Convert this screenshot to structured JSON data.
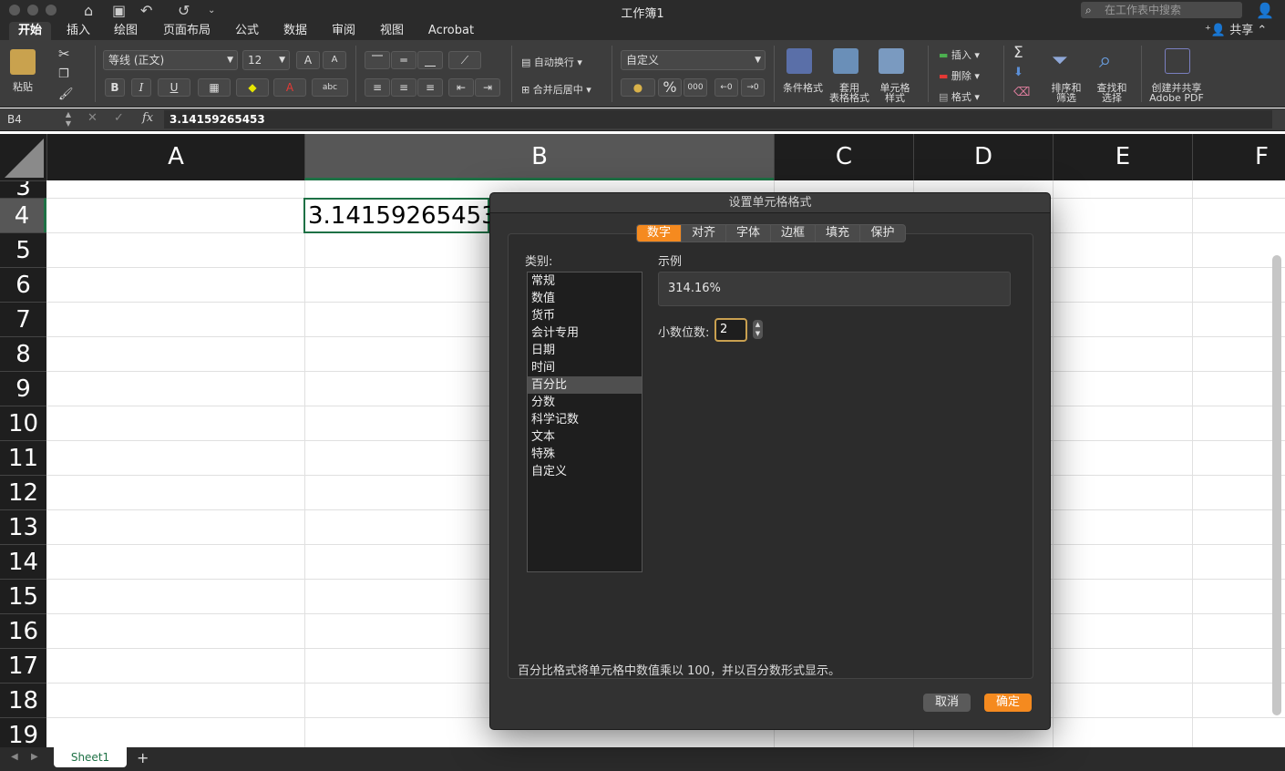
{
  "window": {
    "title": "工作簿1"
  },
  "search": {
    "placeholder": "在工作表中搜索"
  },
  "share": {
    "label": "共享"
  },
  "tabs": [
    "开始",
    "插入",
    "绘图",
    "页面布局",
    "公式",
    "数据",
    "审阅",
    "视图",
    "Acrobat"
  ],
  "ribbon": {
    "paste": "粘贴",
    "font_name": "等线 (正文)",
    "font_size": "12",
    "wrap_text": "自动换行",
    "merge_center": "合并后居中",
    "number_format": "自定义",
    "cond_format": "条件格式",
    "table_format_1": "套用",
    "table_format_2": "表格格式",
    "cell_style_1": "单元格",
    "cell_style_2": "样式",
    "insert": "插入",
    "delete": "删除",
    "format": "格式",
    "sort_1": "排序和",
    "sort_2": "筛选",
    "find_1": "查找和",
    "find_2": "选择",
    "pdf_1": "创建并共享",
    "pdf_2": "Adobe PDF",
    "bold": "B",
    "italic": "I",
    "underline": "U",
    "percent": "%",
    "thousands": "000",
    "abc": "abc",
    "font_grow": "A",
    "font_shrink": "A"
  },
  "formula_bar": {
    "cell_ref": "B4",
    "fx": "fx",
    "value": "3.14159265453"
  },
  "columns": [
    "A",
    "B",
    "C",
    "D",
    "E",
    "F"
  ],
  "rows": [
    "3",
    "4",
    "5",
    "6",
    "7",
    "8",
    "9",
    "10",
    "11",
    "12",
    "13",
    "14",
    "15",
    "16",
    "17",
    "18",
    "19"
  ],
  "selected_cell": {
    "value": "3.14159265453"
  },
  "sheet": {
    "name": "Sheet1",
    "add": "+"
  },
  "dialog": {
    "title": "设置单元格格式",
    "tabs": [
      "数字",
      "对齐",
      "字体",
      "边框",
      "填充",
      "保护"
    ],
    "category_label": "类别:",
    "categories": [
      "常规",
      "数值",
      "货币",
      "会计专用",
      "日期",
      "时间",
      "百分比",
      "分数",
      "科学记数",
      "文本",
      "特殊",
      "自定义"
    ],
    "selected_category": "百分比",
    "sample_label": "示例",
    "sample_value": "314.16%",
    "decimals_label": "小数位数:",
    "decimals_value": "2",
    "description": "百分比格式将单元格中数值乘以 100，并以百分数形式显示。",
    "cancel": "取消",
    "ok": "确定"
  },
  "colors": {
    "accent": "#f58a1f",
    "excel_green": "#1e7145"
  }
}
